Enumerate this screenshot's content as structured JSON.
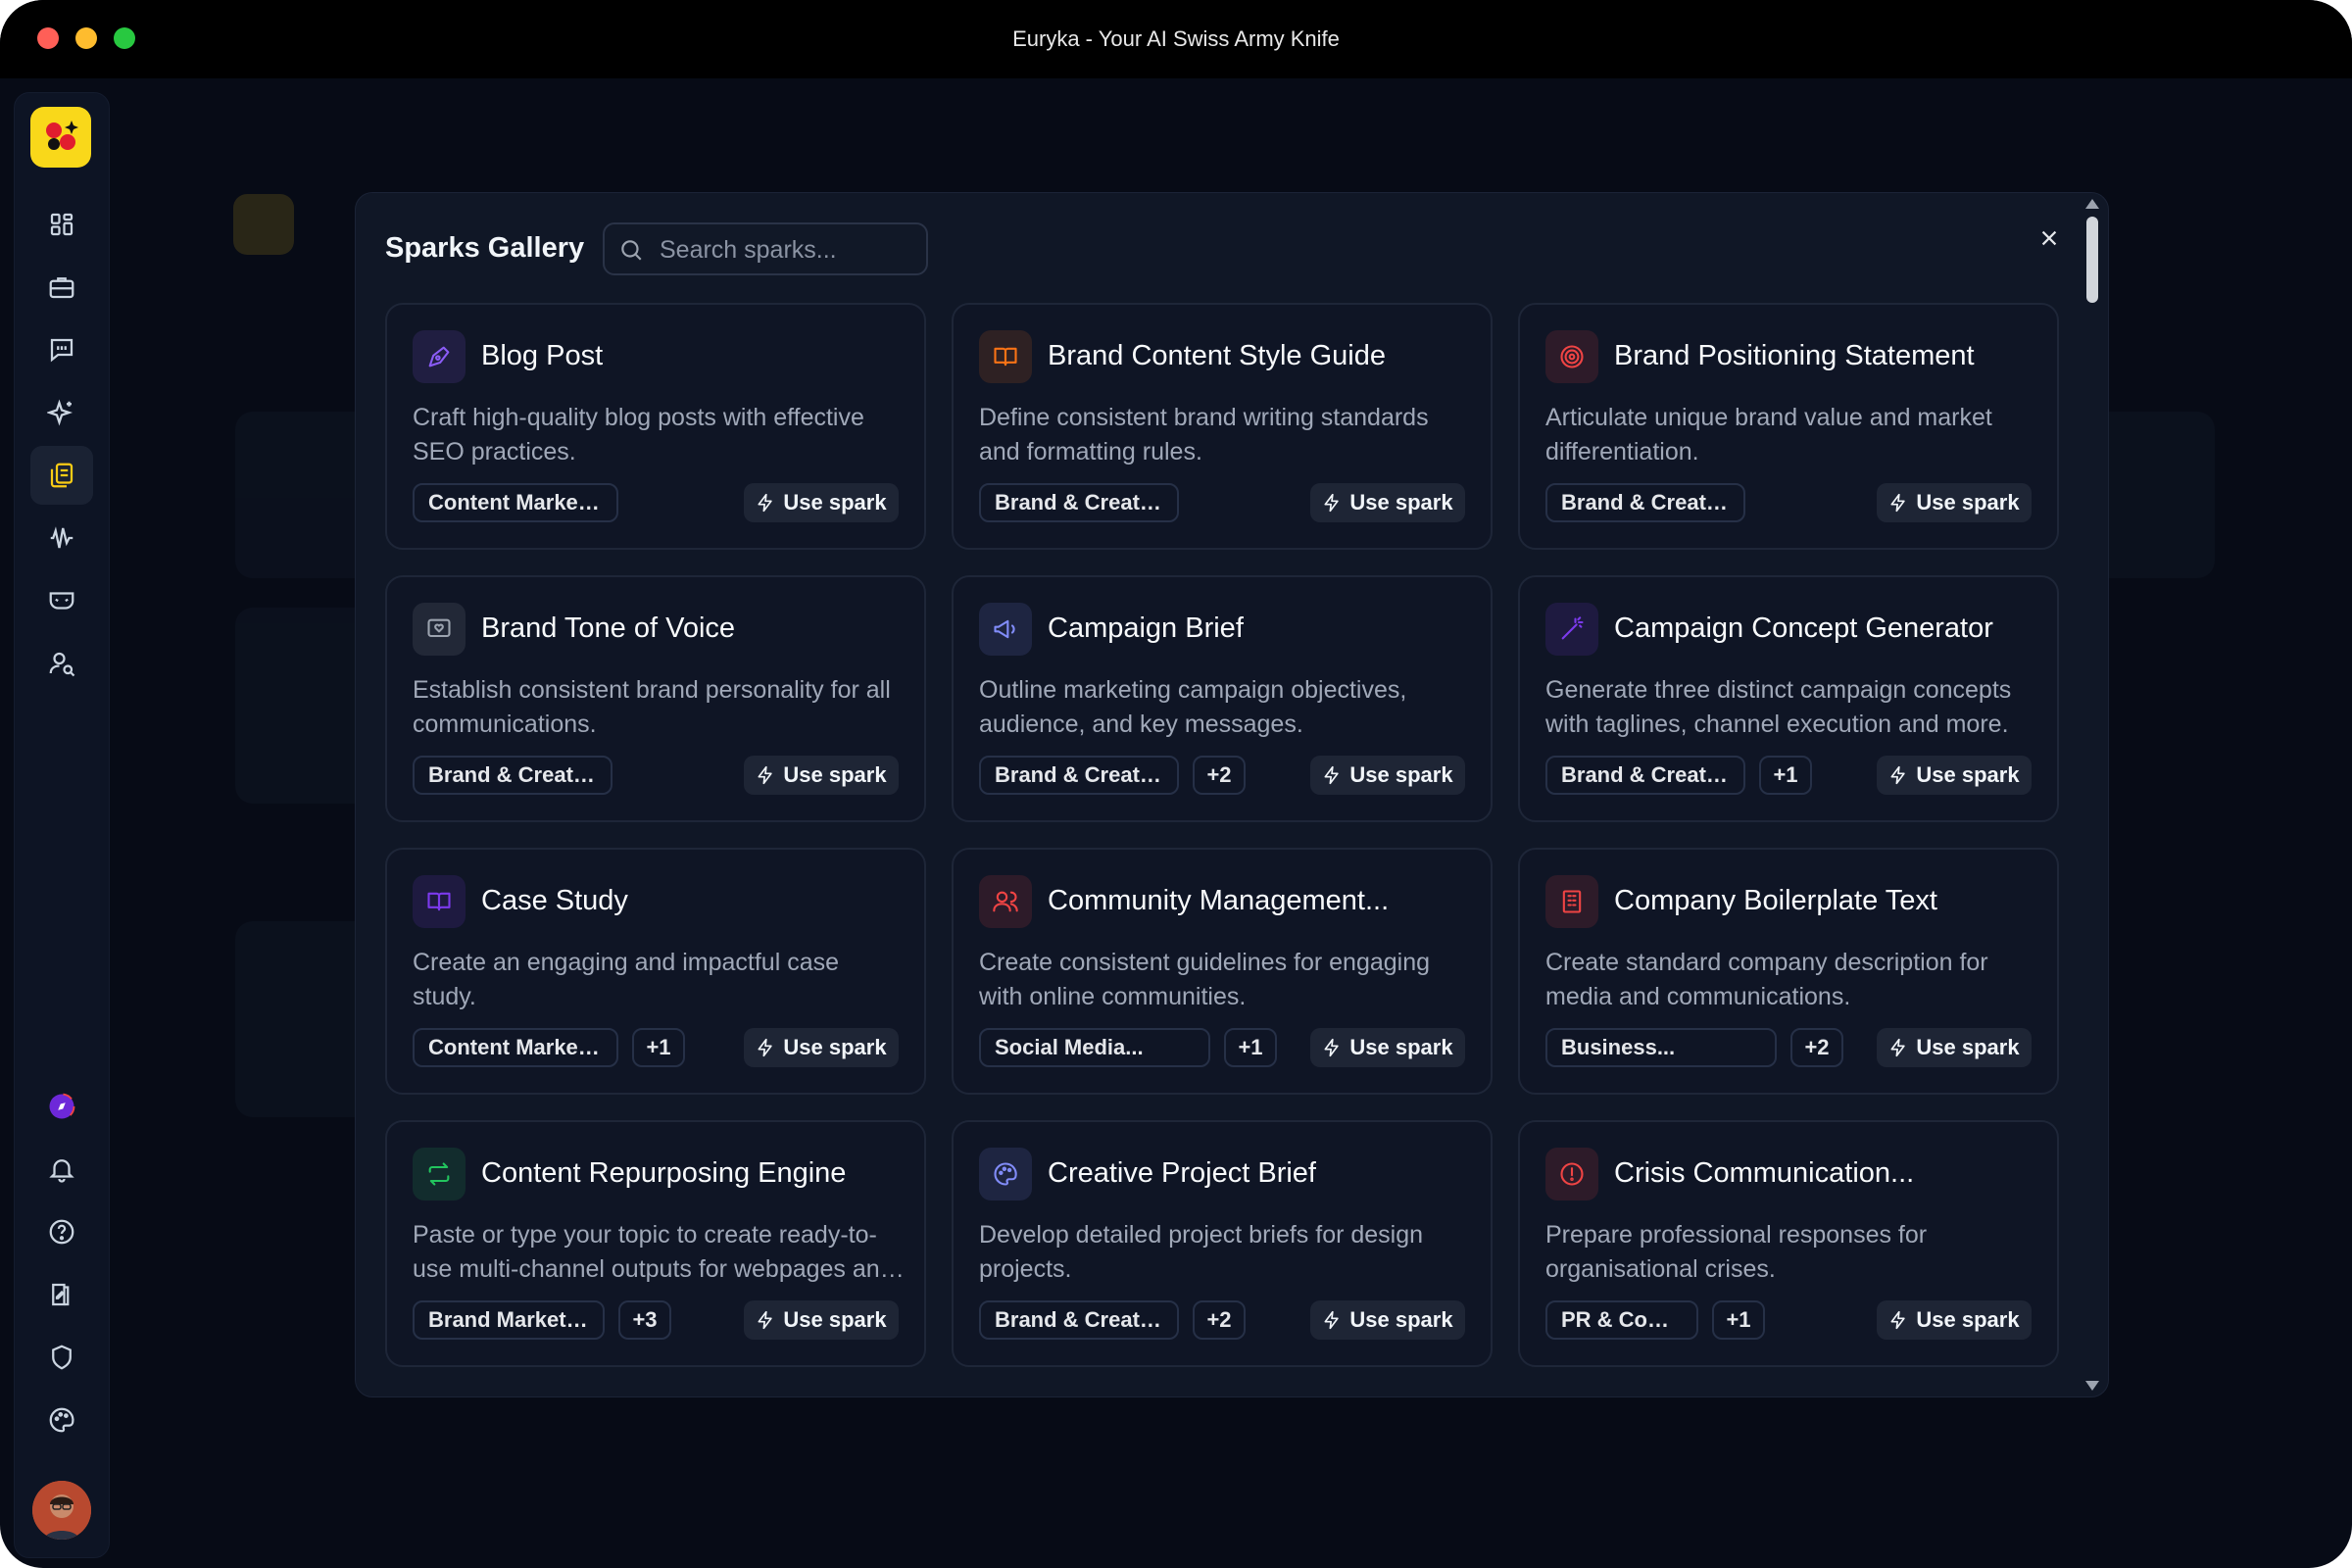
{
  "window": {
    "title": "Euryka - Your AI Swiss Army Knife"
  },
  "sidebar": {
    "items": [
      {
        "icon": "grid-icon"
      },
      {
        "icon": "briefcase-icon"
      },
      {
        "icon": "chat-icon"
      },
      {
        "icon": "sparkles-icon"
      },
      {
        "icon": "copy-icon",
        "active": true
      },
      {
        "icon": "waveform-icon"
      },
      {
        "icon": "mask-icon"
      },
      {
        "icon": "user-search-icon"
      }
    ],
    "bottom_items": [
      {
        "icon": "compass-icon"
      },
      {
        "icon": "bell-icon"
      },
      {
        "icon": "help-icon"
      },
      {
        "icon": "book-edit-icon"
      },
      {
        "icon": "shield-icon"
      },
      {
        "icon": "palette-icon"
      }
    ]
  },
  "modal": {
    "title": "Sparks Gallery",
    "search_placeholder": "Search sparks...",
    "use_label": "Use spark",
    "cards": [
      {
        "title": "Blog Post",
        "desc": "Craft high-quality blog posts with effective SEO practices.",
        "tag": "Content Marketing",
        "more": "",
        "icon": "pen-tool-icon",
        "color": "#8b5cf6"
      },
      {
        "title": "Brand Content Style Guide",
        "desc": "Define consistent brand writing standards and formatting rules.",
        "tag": "Brand & Creative",
        "more": "",
        "icon": "open-book-icon",
        "color": "#f97316"
      },
      {
        "title": "Brand Positioning Statement",
        "desc": "Articulate unique brand value and market differentiation.",
        "tag": "Brand & Creative",
        "more": "",
        "icon": "target-icon",
        "color": "#ef4444"
      },
      {
        "title": "Brand Tone of Voice",
        "desc": "Establish consistent brand personality for all communications.",
        "tag": "Brand & Creative",
        "more": "",
        "icon": "message-heart-icon",
        "color": "#9ca3af"
      },
      {
        "title": "Campaign Brief",
        "desc": "Outline marketing campaign objectives, audience, and key messages.",
        "tag": "Brand & Creative",
        "more": "+2",
        "icon": "megaphone-icon",
        "color": "#818cf8"
      },
      {
        "title": "Campaign Concept Generator",
        "desc": "Generate three distinct campaign concepts with taglines, channel execution and more.",
        "tag": "Brand & Creative",
        "more": "+1",
        "icon": "magic-wand-icon",
        "color": "#7c3aed"
      },
      {
        "title": "Case Study",
        "desc": "Create an engaging and impactful case study.",
        "tag": "Content Marketing",
        "more": "+1",
        "icon": "book-icon",
        "color": "#7c3aed"
      },
      {
        "title": "Community Management...",
        "desc": "Create consistent guidelines for engaging with online communities.",
        "tag": "Social Media...",
        "more": "+1",
        "icon": "users-icon",
        "color": "#ef4444"
      },
      {
        "title": "Company Boilerplate Text",
        "desc": "Create standard company description for media and communications.",
        "tag": "Business...",
        "more": "+2",
        "icon": "building-icon",
        "color": "#ef4444"
      },
      {
        "title": "Content Repurposing Engine",
        "desc": "Paste or type your topic to create ready-to-use multi-channel outputs for webpages and more.",
        "tag": "Brand Marketing",
        "more": "+3",
        "icon": "repeat-icon",
        "color": "#22c55e"
      },
      {
        "title": "Creative Project Brief",
        "desc": "Develop detailed project briefs for design projects.",
        "tag": "Brand & Creative",
        "more": "+2",
        "icon": "palette-icon",
        "color": "#818cf8"
      },
      {
        "title": "Crisis Communication...",
        "desc": "Prepare professional responses for organisational crises.",
        "tag": "PR & Comms",
        "more": "+1",
        "icon": "alert-circle-icon",
        "color": "#ef4444"
      }
    ]
  }
}
